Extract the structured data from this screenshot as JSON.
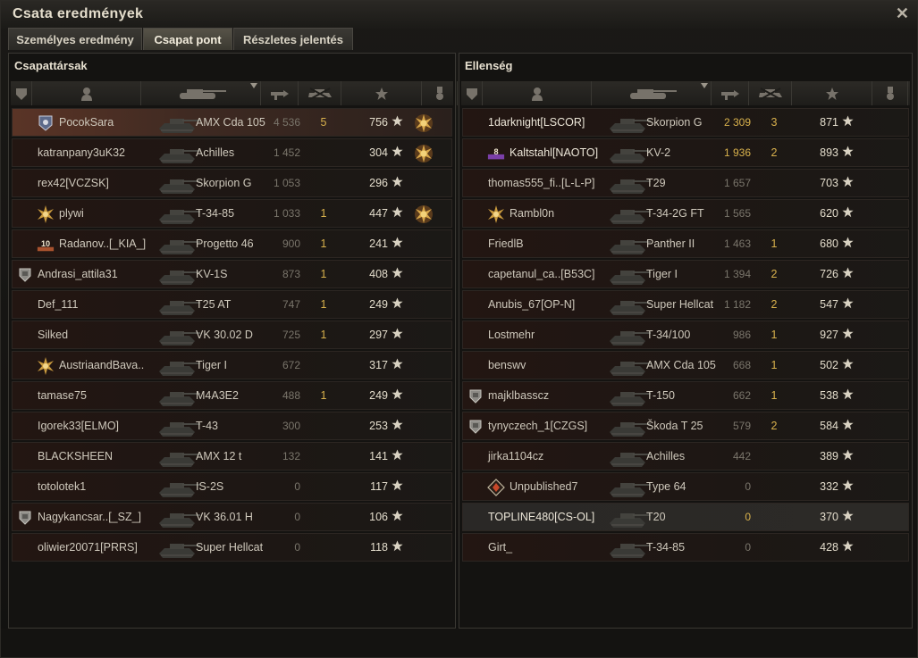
{
  "window": {
    "title": "Csata eredmények",
    "close_icon": "close-icon"
  },
  "tabs": [
    {
      "label": "Személyes eredmény",
      "active": false
    },
    {
      "label": "Csapat pont",
      "active": true
    },
    {
      "label": "Részletes jelentés",
      "active": false
    }
  ],
  "colors": {
    "gold": "#d8b14c",
    "highlight": "#5a3426",
    "text": "#cfc9bc"
  },
  "allies": {
    "title": "Csapattársak",
    "columns": [
      "squad-icon",
      "player-icon",
      "tank-icon",
      "damage-icon",
      "kills-icon",
      "xp-star-icon",
      "medal-icon"
    ],
    "rows": [
      {
        "name": "PocokSara",
        "badge": "rank-emblem",
        "tank": "AMX Cda 105",
        "damage": "4 536",
        "kills": "5",
        "xp": "756",
        "medal": true,
        "highlight": true
      },
      {
        "name": "katranpany3uK32",
        "tank": "Achilles",
        "damage": "1 452",
        "kills": "",
        "xp": "304",
        "medal": true
      },
      {
        "name": "rex42[VCZSK]",
        "tank": "Skorpion G",
        "damage": "1 053",
        "kills": "",
        "xp": "296"
      },
      {
        "name": "plywi",
        "badge": "gold-star",
        "tank": "T-34-85",
        "damage": "1 033",
        "kills": "1",
        "xp": "447",
        "medal": true
      },
      {
        "name": "Radanov..[_KIA_]",
        "badge": "ten",
        "tank": "Progetto 46",
        "damage": "900",
        "kills": "1",
        "xp": "241"
      },
      {
        "name": "Andrasi_attila31",
        "shield": true,
        "tank": "KV-1S",
        "damage": "873",
        "kills": "1",
        "xp": "408"
      },
      {
        "name": "Def_111",
        "tank": "T25 AT",
        "damage": "747",
        "kills": "1",
        "xp": "249"
      },
      {
        "name": "Silked",
        "tank": "VK 30.02 D",
        "damage": "725",
        "kills": "1",
        "xp": "297"
      },
      {
        "name": "AustriaandBava..",
        "badge": "gold-star",
        "tank": "Tiger I",
        "damage": "672",
        "kills": "",
        "xp": "317"
      },
      {
        "name": "tamase75",
        "tank": "M4A3E2",
        "damage": "488",
        "kills": "1",
        "xp": "249"
      },
      {
        "name": "Igorek33[ELMO]",
        "tank": "T-43",
        "damage": "300",
        "kills": "",
        "xp": "253"
      },
      {
        "name": "BLACKSHEEN",
        "tank": "AMX 12 t",
        "damage": "132",
        "kills": "",
        "xp": "141"
      },
      {
        "name": "totolotek1",
        "tank": "IS-2S",
        "damage": "0",
        "kills": "",
        "xp": "117"
      },
      {
        "name": "Nagykancsar..[_SZ_]",
        "shield": true,
        "tank": "VK 36.01 H",
        "damage": "0",
        "kills": "",
        "xp": "106"
      },
      {
        "name": "oliwier20071[PRRS]",
        "tank": "Super Hellcat",
        "damage": "0",
        "kills": "",
        "xp": "118"
      }
    ]
  },
  "enemies": {
    "title": "Ellenség",
    "rows": [
      {
        "name": "1darknight[LSCOR]",
        "tank": "Skorpion G",
        "damage": "2 309",
        "kills": "3",
        "xp": "871",
        "gold": true,
        "white": true
      },
      {
        "name": "Kaltstahl[NAOTO]",
        "badge": "eight",
        "tank": "KV-2",
        "damage": "1 936",
        "kills": "2",
        "xp": "893",
        "gold": true,
        "white": true
      },
      {
        "name": "thomas555_fi..[L-L-P]",
        "tank": "T29",
        "damage": "1 657",
        "kills": "",
        "xp": "703"
      },
      {
        "name": "Rambl0n",
        "badge": "gold-star",
        "tank": "T-34-2G FT",
        "damage": "1 565",
        "kills": "",
        "xp": "620"
      },
      {
        "name": "FriedlB",
        "tank": "Panther II",
        "damage": "1 463",
        "kills": "1",
        "xp": "680"
      },
      {
        "name": "capetanul_ca..[B53C]",
        "tank": "Tiger I",
        "damage": "1 394",
        "kills": "2",
        "xp": "726"
      },
      {
        "name": "Anubis_67[OP-N]",
        "tank": "Super Hellcat",
        "damage": "1 182",
        "kills": "2",
        "xp": "547"
      },
      {
        "name": "Lostmehr",
        "tank": "T-34/100",
        "damage": "986",
        "kills": "1",
        "xp": "927"
      },
      {
        "name": "benswv",
        "tank": "AMX Cda 105",
        "damage": "668",
        "kills": "1",
        "xp": "502"
      },
      {
        "name": "majklbasscz",
        "shield": true,
        "tank": "T-150",
        "damage": "662",
        "kills": "1",
        "xp": "538"
      },
      {
        "name": "tynyczech_1[CZGS]",
        "shield": true,
        "tank": "Škoda T 25",
        "damage": "579",
        "kills": "2",
        "xp": "584"
      },
      {
        "name": "jirka1104cz",
        "tank": "Achilles",
        "damage": "442",
        "kills": "",
        "xp": "389"
      },
      {
        "name": "Unpublished7",
        "badge": "diamond",
        "tank": "Type 64",
        "damage": "0",
        "kills": "",
        "xp": "332"
      },
      {
        "name": "TOPLINE480[CS-OL]",
        "tank": "T20",
        "damage": "0",
        "kills": "",
        "xp": "370",
        "gold": true,
        "white": true,
        "highlight2": true
      },
      {
        "name": "Girt_",
        "tank": "T-34-85",
        "damage": "0",
        "kills": "",
        "xp": "428"
      }
    ]
  }
}
